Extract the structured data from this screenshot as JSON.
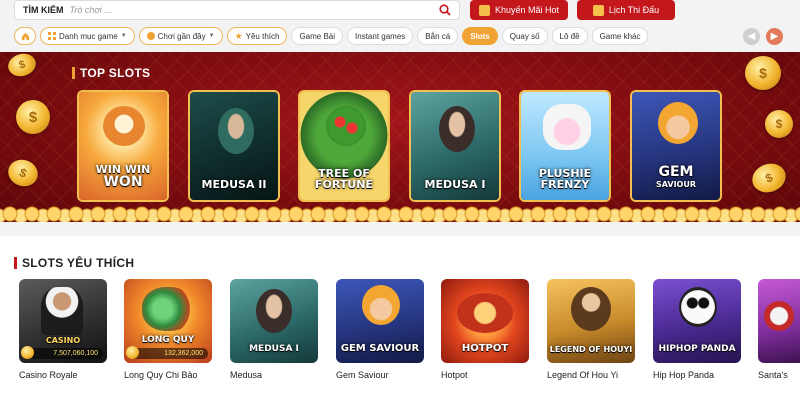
{
  "search": {
    "label": "TÌM KIẾM",
    "placeholder": "Trò chơi ..."
  },
  "header_buttons": {
    "promo": "Khuyến Mãi Hot",
    "schedule": "Lịch Thi Đấu"
  },
  "filters": {
    "category": "Danh mục game",
    "recent": "Chơi gần đây",
    "favorite": "Yêu thích",
    "tabs": [
      "Game Bài",
      "Instant games",
      "Bắn cá",
      "Slots",
      "Quay số",
      "Lô đề",
      "Game khác"
    ],
    "active_tab": "Slots"
  },
  "top_slots": {
    "title": "TOP SLOTS",
    "games": [
      {
        "line1": "WIN WIN",
        "line2": "WON"
      },
      {
        "line1": "MEDUSA II",
        "line2": ""
      },
      {
        "line1": "TREE OF",
        "line2": "FORTUNE"
      },
      {
        "line1": "MEDUSA I",
        "line2": ""
      },
      {
        "line1": "PLUSHIE",
        "line2": "FRENZY"
      },
      {
        "line1": "GEM",
        "line2": "SAVIOUR"
      }
    ]
  },
  "favorites": {
    "title": "SLOTS YÊU THÍCH",
    "games": [
      {
        "art": "CASINO",
        "jackpot": "7,507,060,100",
        "name": "Casino Royale"
      },
      {
        "art": "LONG QUY",
        "jackpot": "132,362,000",
        "name": "Long Quy Chi Bảo"
      },
      {
        "art": "MEDUSA I",
        "jackpot": "",
        "name": "Medusa"
      },
      {
        "art": "GEM SAVIOUR",
        "jackpot": "",
        "name": "Gem Saviour"
      },
      {
        "art": "HOTPOT",
        "jackpot": "",
        "name": "Hotpot"
      },
      {
        "art": "LEGEND OF HOUYI",
        "jackpot": "",
        "name": "Legend Of Hou Yi"
      },
      {
        "art": "HIPHOP PANDA",
        "jackpot": "",
        "name": "Hip Hop Panda"
      },
      {
        "art": "",
        "jackpot": "",
        "name": "Santa's"
      }
    ]
  },
  "colors": {
    "brand_red": "#c4171c",
    "accent_orange": "#f0a233",
    "banner_red": "#8e1015"
  },
  "icons": [
    "search-icon",
    "gift-icon",
    "calendar-icon",
    "home-icon",
    "grid-icon",
    "clock-icon",
    "star-icon",
    "arrow-left-icon",
    "arrow-right-icon",
    "coin-icon"
  ]
}
